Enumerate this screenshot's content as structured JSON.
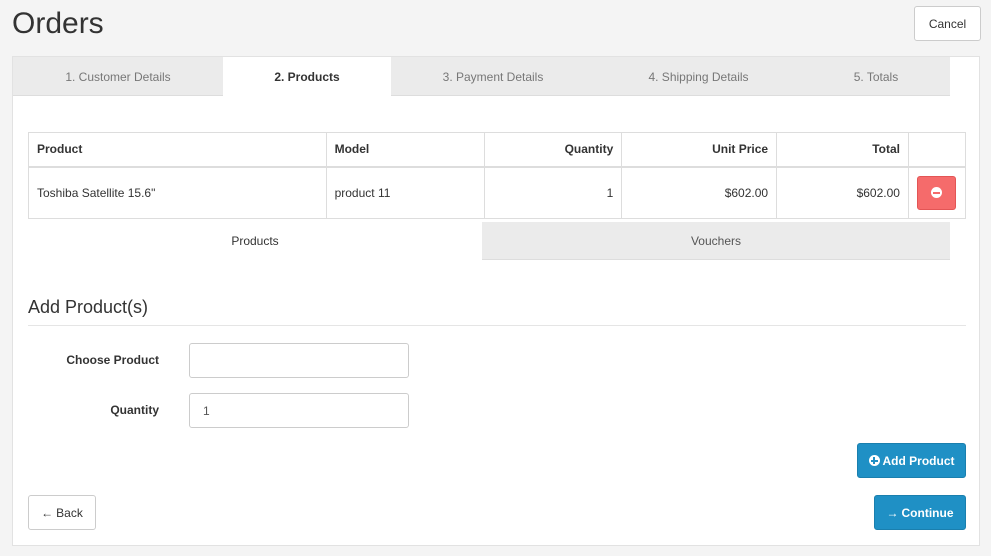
{
  "page": {
    "title": "Orders",
    "cancel_label": "Cancel"
  },
  "steps": [
    {
      "label": "1. Customer Details",
      "active": false
    },
    {
      "label": "2. Products",
      "active": true
    },
    {
      "label": "3. Payment Details",
      "active": false
    },
    {
      "label": "4. Shipping Details",
      "active": false
    },
    {
      "label": "5. Totals",
      "active": false
    }
  ],
  "table": {
    "headers": {
      "product": "Product",
      "model": "Model",
      "quantity": "Quantity",
      "unit_price": "Unit Price",
      "total": "Total"
    },
    "rows": [
      {
        "product": "Toshiba Satellite 15.6\"",
        "model": "product 11",
        "quantity": "1",
        "unit_price": "$602.00",
        "total": "$602.00"
      }
    ]
  },
  "sub_tabs": {
    "products": "Products",
    "vouchers": "Vouchers"
  },
  "add_product": {
    "title": "Add Product(s)",
    "choose_label": "Choose Product",
    "choose_value": "",
    "quantity_label": "Quantity",
    "quantity_value": "1",
    "add_button": "Add Product"
  },
  "footer": {
    "back_label": "Back",
    "continue_label": "Continue"
  },
  "colors": {
    "primary": "#1f90c5",
    "danger": "#f56b6b"
  },
  "icons": {
    "remove": "minus-circle-icon",
    "add": "plus-circle-icon",
    "back": "arrow-left-icon",
    "continue": "arrow-right-icon"
  }
}
